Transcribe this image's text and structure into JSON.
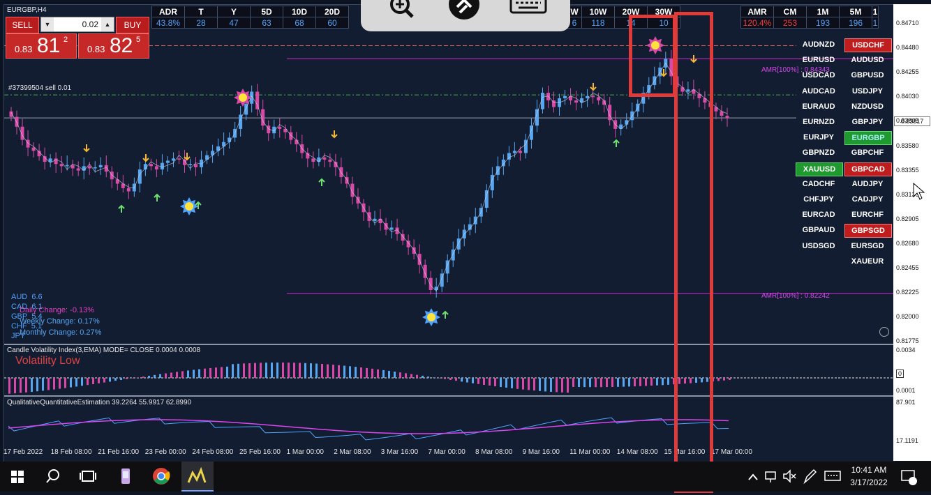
{
  "chart_title": "EURGBP,H4",
  "trade": {
    "sell_label": "SELL",
    "buy_label": "BUY",
    "lot": "0.02",
    "bid_prefix": "0.83",
    "bid_big": "81",
    "bid_sup": "2",
    "ask_prefix": "0.83",
    "ask_big": "82",
    "ask_sup": "5"
  },
  "stats_left": {
    "headers": [
      "ADR",
      "T",
      "Y",
      "5D",
      "10D",
      "20D"
    ],
    "values": [
      "43.8%",
      "28",
      "47",
      "63",
      "68",
      "60"
    ]
  },
  "stats_mid": {
    "headers": [
      "W",
      "10W",
      "20W",
      "30W"
    ],
    "values": [
      "6",
      "118",
      "14",
      "10"
    ]
  },
  "stats_right": {
    "headers": [
      "AMR",
      "CM",
      "1M",
      "5M",
      "1"
    ],
    "values": [
      "120.4%",
      "253",
      "193",
      "196",
      "1"
    ]
  },
  "order_line_label": "#37399504 sell 0.01",
  "amr_high_label": "AMR[100%] : 0.84343",
  "amr_low_label": "AMR[100%] : 0.82242",
  "price_ticks": [
    "0.84710",
    "0.84480",
    "0.84255",
    "0.84030",
    "0.83805",
    "0.83580",
    "0.83355",
    "0.83130",
    "0.82905",
    "0.82680",
    "0.82455",
    "0.82225",
    "0.82000",
    "0.81775"
  ],
  "current_price": "0.83817",
  "vol_ticks": [
    "0.0034",
    "0.0001"
  ],
  "vol_zero": "0",
  "qqe_ticks": [
    "87.901",
    "17.1191"
  ],
  "symbols_left": [
    "AUDNZD",
    "EURUSD",
    "USDCAD",
    "AUDCAD",
    "EURAUD",
    "EURNZD",
    "EURJPY",
    "GBPNZD",
    "XAUUSD",
    "CADCHF",
    "CHFJPY",
    "EURCAD",
    "GBPAUD",
    "USDSGD"
  ],
  "symbols_right": [
    "USDCHF",
    "AUDUSD",
    "GBPUSD",
    "USDJPY",
    "NZDUSD",
    "GBPJPY",
    "EURGBP",
    "GBPCHF",
    "GBPCAD",
    "AUDJPY",
    "CADJPY",
    "EURCHF",
    "GBPSGD",
    "EURSGD",
    "XAUEUR"
  ],
  "currency_strength": [
    {
      "cur": "AUD",
      "val": "6.6"
    },
    {
      "cur": "CAD",
      "val": "6.1"
    },
    {
      "cur": "GBP",
      "val": "5.4"
    },
    {
      "cur": "CHF",
      "val": "5.1"
    },
    {
      "cur": "JPY",
      "val": ""
    }
  ],
  "daily_change": "Daily Change: -0.13%",
  "weekly_change": "Weekly Change: 0.17%",
  "monthly_change": "Monthly Change: 0.27%",
  "vol_title": "Candle Volatility Index(3,EMA) MODE= CLOSE 0.0004 0.0008",
  "vol_status": "Volatility Low",
  "qqe_title": "QualitativeQuantitativeEstimation 39.2264 55.9917 62.8990",
  "time_labels": [
    "17 Feb 2022",
    "18 Feb 08:00",
    "21 Feb 16:00",
    "23 Feb 00:00",
    "24 Feb 08:00",
    "25 Feb 16:00",
    "1 Mar 00:00",
    "2 Mar 08:00",
    "3 Mar 16:00",
    "7 Mar 00:00",
    "8 Mar 08:00",
    "9 Mar 16:00",
    "11 Mar 00:00",
    "14 Mar 08:00",
    "15 Mar 16:00",
    "17 Mar 00:00"
  ],
  "taskbar": {
    "time": "10:41 AM",
    "date": "3/17/2022"
  },
  "colors": {
    "bull": "#58a6f0",
    "bear": "#d94aa8",
    "bg": "#131d31",
    "highlight": "#e03b3b",
    "amr": "#cc33cc"
  },
  "chart_data": {
    "type": "candlestick",
    "symbol": "EURGBP",
    "timeframe": "H4",
    "ylim": [
      0.8176,
      0.8475
    ],
    "closes": [
      0.8383,
      0.8374,
      0.8362,
      0.8355,
      0.8352,
      0.8347,
      0.8342,
      0.8345,
      0.834,
      0.8338,
      0.8339,
      0.8336,
      0.8334,
      0.8338,
      0.8336,
      0.8337,
      0.8339,
      0.8333,
      0.8326,
      0.8322,
      0.8318,
      0.8315,
      0.8322,
      0.8335,
      0.834,
      0.8338,
      0.8335,
      0.8341,
      0.8343,
      0.8345,
      0.8344,
      0.8339,
      0.834,
      0.8337,
      0.8344,
      0.8348,
      0.8352,
      0.8356,
      0.836,
      0.8364,
      0.8372,
      0.8385,
      0.8395,
      0.8406,
      0.839,
      0.8375,
      0.8368,
      0.8374,
      0.8372,
      0.8369,
      0.8362,
      0.8358,
      0.835,
      0.8345,
      0.8342,
      0.8346,
      0.8344,
      0.8342,
      0.8337,
      0.8328,
      0.8322,
      0.831,
      0.8304,
      0.8296,
      0.8288,
      0.829,
      0.8286,
      0.828,
      0.8282,
      0.8276,
      0.827,
      0.8264,
      0.8258,
      0.8248,
      0.8236,
      0.8225,
      0.8228,
      0.824,
      0.8252,
      0.8262,
      0.8272,
      0.828,
      0.8285,
      0.8292,
      0.83,
      0.8316,
      0.833,
      0.8338,
      0.8344,
      0.835,
      0.8352,
      0.835,
      0.8362,
      0.8375,
      0.839,
      0.8405,
      0.8398,
      0.8392,
      0.84,
      0.8402,
      0.8398,
      0.8396,
      0.84,
      0.8402,
      0.8401,
      0.8398,
      0.8394,
      0.838,
      0.8372,
      0.8376,
      0.838,
      0.8388,
      0.8395,
      0.8405,
      0.8412,
      0.842,
      0.8428,
      0.8436,
      0.842,
      0.841,
      0.8406,
      0.8408,
      0.8404,
      0.84,
      0.8396,
      0.8392,
      0.8388,
      0.8384,
      0.8382
    ]
  }
}
